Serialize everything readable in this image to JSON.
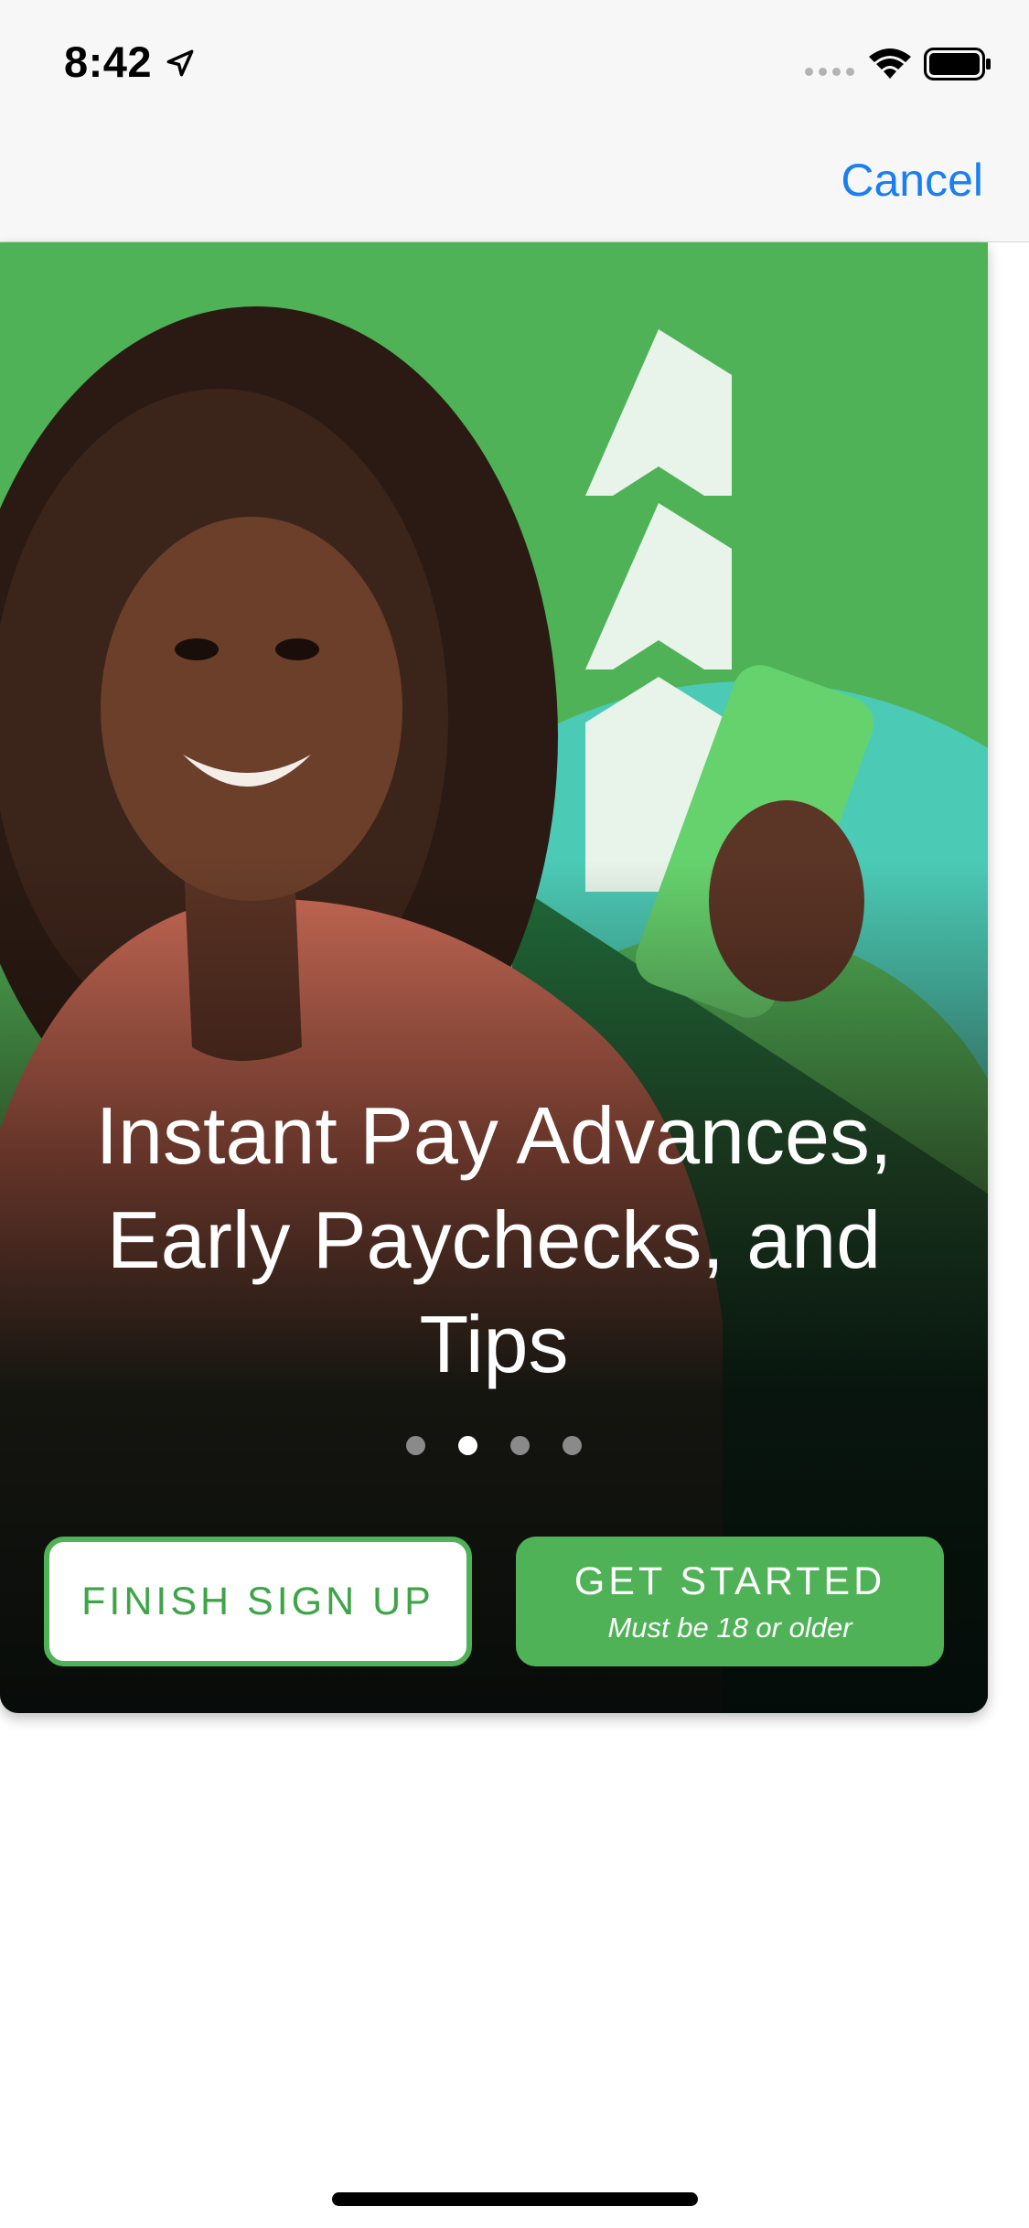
{
  "status_bar": {
    "time": "8:42"
  },
  "nav": {
    "cancel_label": "Cancel"
  },
  "onboarding": {
    "headline": "Instant Pay Advances, Early Paychecks, and Tips",
    "page_count": 4,
    "current_page": 2,
    "finish_signup_label": "FINISH SIGN UP",
    "get_started_label": "GET STARTED",
    "get_started_note": "Must be 18 or older"
  },
  "icons": {
    "location": "location-arrow-icon",
    "signal": "cellular-signal-icon",
    "wifi": "wifi-icon",
    "battery": "battery-icon"
  },
  "colors": {
    "accent_green": "#4fb257",
    "teal": "#4bcab5",
    "link_blue": "#1a7ff0",
    "nav_background": "#f7f7f7"
  }
}
